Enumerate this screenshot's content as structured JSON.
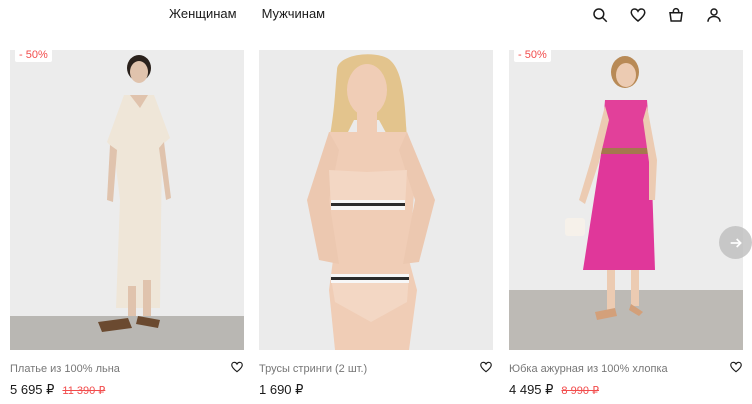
{
  "header": {
    "nav": [
      {
        "label": "Женщинам"
      },
      {
        "label": "Мужчинам"
      }
    ],
    "icons": [
      "search-icon",
      "heart-icon",
      "bag-icon",
      "user-icon"
    ]
  },
  "products": [
    {
      "badge": "- 50%",
      "title": "Платье из 100% льна",
      "price": "5 695 ₽",
      "old_price": "11 390 ₽"
    },
    {
      "badge": "",
      "title": "Трусы стринги (2 шт.)",
      "price": "1 690 ₽",
      "old_price": ""
    },
    {
      "badge": "- 50%",
      "title": "Юбка ажурная из 100% хлопка",
      "price": "4 495 ₽",
      "old_price": "8 990 ₽"
    }
  ],
  "colors": {
    "text": "#1a1a1a",
    "muted": "#777777",
    "sale": "#f24c4c",
    "photo_bg": "#e9e9e9"
  }
}
